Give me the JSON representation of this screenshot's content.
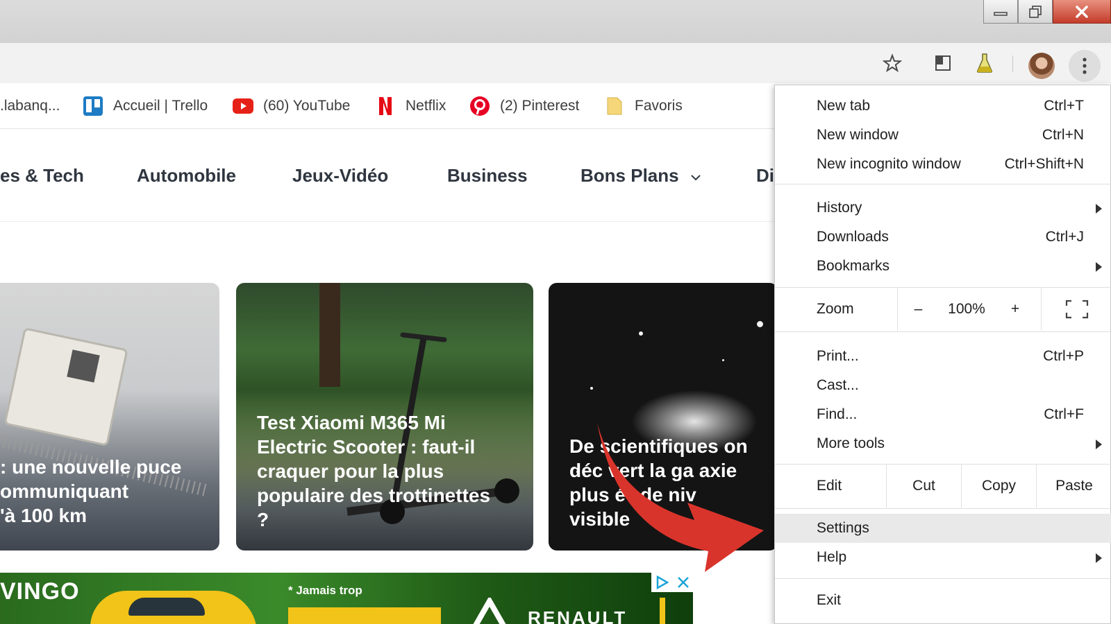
{
  "bookmarks": [
    {
      "label": ".labanq...",
      "icon": "bank-icon"
    },
    {
      "label": "Accueil | Trello",
      "icon": "trello-icon"
    },
    {
      "label": "(60) YouTube",
      "icon": "youtube-icon"
    },
    {
      "label": "Netflix",
      "icon": "netflix-icon"
    },
    {
      "label": "(2) Pinterest",
      "icon": "pinterest-icon"
    },
    {
      "label": "Favoris",
      "icon": "folder-icon"
    }
  ],
  "site_nav": [
    "es & Tech",
    "Automobile",
    "Jeux-Vidéo",
    "Business",
    "Bons Plans",
    "Di"
  ],
  "cards": [
    {
      "title_lines": [
        ": une nouvelle puce",
        "ommuniquant",
        "'à 100 km"
      ]
    },
    {
      "title_lines": [
        "Test Xiaomi M365 Mi",
        "Electric Scooter : faut-il",
        "craquer pour la plus",
        "populaire des trottinettes",
        "?"
      ]
    },
    {
      "title_lines": [
        "De scientifiques on",
        "déc  vert la ga axie",
        "plus  é\" de  niv",
        "visible"
      ]
    }
  ],
  "ad": {
    "brand": "VINGO",
    "tagline": "* Jamais trop",
    "renault": "RENAULT"
  },
  "menu": {
    "new_tab": {
      "label": "New tab",
      "shortcut": "Ctrl+T"
    },
    "new_window": {
      "label": "New window",
      "shortcut": "Ctrl+N"
    },
    "incognito": {
      "label": "New incognito window",
      "shortcut": "Ctrl+Shift+N"
    },
    "history": {
      "label": "History"
    },
    "downloads": {
      "label": "Downloads",
      "shortcut": "Ctrl+J"
    },
    "bookmarks": {
      "label": "Bookmarks"
    },
    "zoom": {
      "label": "Zoom",
      "minus": "–",
      "level": "100%",
      "plus": "+"
    },
    "print": {
      "label": "Print...",
      "shortcut": "Ctrl+P"
    },
    "cast": {
      "label": "Cast..."
    },
    "find": {
      "label": "Find...",
      "shortcut": "Ctrl+F"
    },
    "more_tools": {
      "label": "More tools"
    },
    "edit": {
      "label": "Edit",
      "cut": "Cut",
      "copy": "Copy",
      "paste": "Paste"
    },
    "settings": {
      "label": "Settings"
    },
    "help": {
      "label": "Help"
    },
    "exit": {
      "label": "Exit"
    }
  },
  "colors": {
    "accent_arrow": "#d9342b",
    "menu_highlight": "#e9e9e9"
  }
}
